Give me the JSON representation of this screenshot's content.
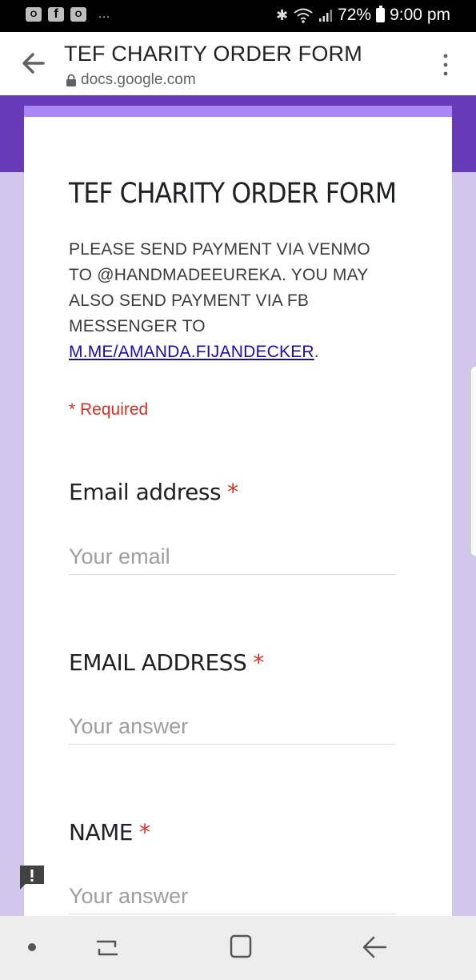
{
  "status_bar": {
    "app_icons": [
      "O",
      "f",
      "O"
    ],
    "more": "…",
    "battery": "72%",
    "time": "9:00 pm"
  },
  "browser": {
    "title": "TEF CHARITY ORDER FORM",
    "url": "docs.google.com"
  },
  "form": {
    "title": "TEF CHARITY ORDER FORM",
    "description_text": "PLEASE SEND PAYMENT VIA VENMO TO @HANDMADEEUREKA. YOU MAY ALSO SEND PAYMENT VIA FB MESSENGER TO ",
    "description_link": "M.ME/AMANDA.FIJANDECKER",
    "description_end": ".",
    "required_note": "* Required",
    "questions": [
      {
        "label": "Email address",
        "star": "*",
        "placeholder": "Your email"
      },
      {
        "label": "EMAIL ADDRESS",
        "star": "*",
        "placeholder": "Your answer"
      },
      {
        "label": "NAME",
        "star": "*",
        "placeholder": "Your answer"
      }
    ]
  },
  "colors": {
    "brand_purple": "#673ab7",
    "card_accent": "#a987f5",
    "background": "#d3c6ec",
    "required_red": "#d93025",
    "link": "#1a0dab"
  },
  "icons": {
    "back": "arrow-left-icon",
    "menu": "more-vert-icon",
    "lock": "lock-icon",
    "feedback": "feedback-icon"
  }
}
